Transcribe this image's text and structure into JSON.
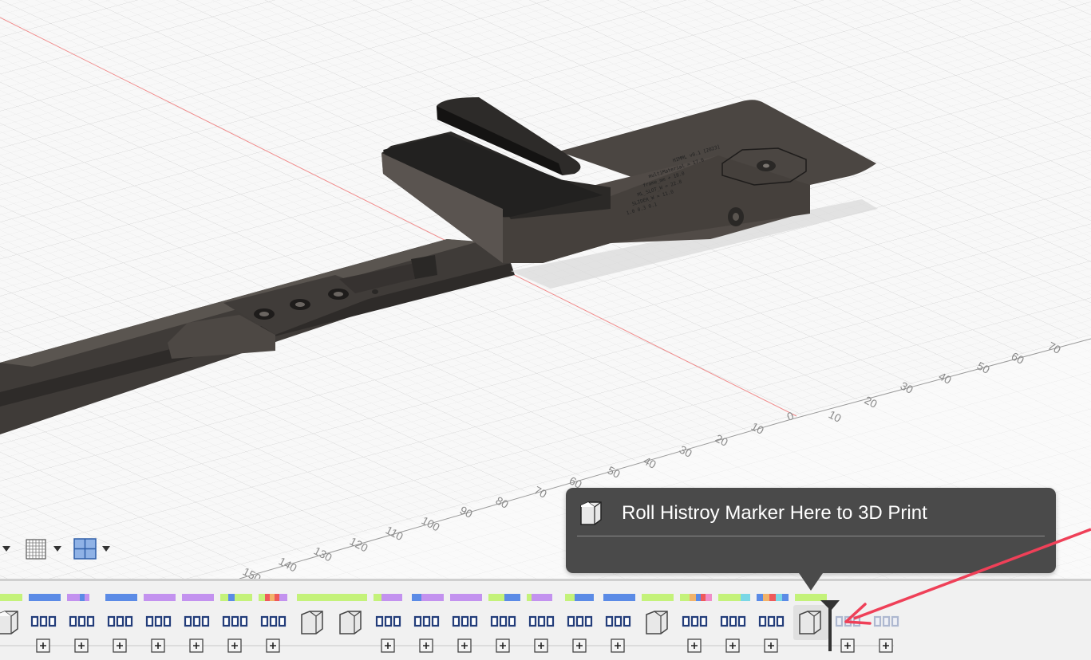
{
  "viewport": {
    "ruler_labels_right": [
      "0",
      "10",
      "20",
      "30",
      "40",
      "50",
      "60",
      "70"
    ],
    "ruler_labels_front": [
      "10",
      "20",
      "30",
      "40",
      "50",
      "60",
      "70",
      "80",
      "90",
      "100",
      "110",
      "120",
      "130",
      "140",
      "150"
    ],
    "engraved_lines": [
      "HIMML v0.1 [2023]",
      "multiMaterial = 17.0",
      "frame_mm + 18.0",
      "ML_SLOT_W = 22.8",
      "SLIDER_W = 11.0",
      "1.0  0.3  0.1"
    ],
    "colors": {
      "model": "#4a4541",
      "model_dark": "#2c2a28",
      "grid": "#e3e3e3",
      "x_axis": "#e88a8a"
    }
  },
  "view_toolbar": {
    "icons": [
      "display-settings-icon",
      "grid-settings-icon",
      "viewports-layout-icon"
    ]
  },
  "timeline": {
    "feature_colors": {
      "green": "#c4f27a",
      "blue": "#5b8be6",
      "purple": "#c392ef",
      "red": "#ef5a5a",
      "orange": "#f2b36a",
      "pink": "#f08ec8",
      "teal": "#7ad7e6"
    },
    "features": [
      "body",
      "group",
      "group",
      "group",
      "group",
      "group",
      "group",
      "group",
      "body",
      "body",
      "group",
      "group",
      "group",
      "group",
      "group",
      "group",
      "group",
      "body",
      "group",
      "group",
      "group",
      "body-selected",
      "group-suppressed",
      "group-suppressed"
    ]
  },
  "tooltip": {
    "title": "Roll Histroy Marker Here to 3D Print",
    "icon": "body-icon"
  },
  "annotation": {
    "arrow_color": "#ef4058"
  }
}
